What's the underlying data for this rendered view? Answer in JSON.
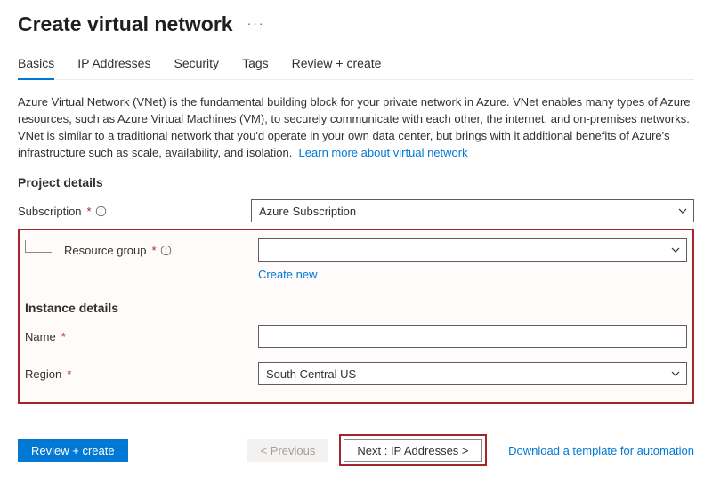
{
  "header": {
    "title": "Create virtual network"
  },
  "tabs": [
    "Basics",
    "IP Addresses",
    "Security",
    "Tags",
    "Review + create"
  ],
  "description": "Azure Virtual Network (VNet) is the fundamental building block for your private network in Azure. VNet enables many types of Azure resources, such as Azure Virtual Machines (VM), to securely communicate with each other, the internet, and on-premises networks. VNet is similar to a traditional network that you'd operate in your own data center, but brings with it additional benefits of Azure's infrastructure such as scale, availability, and isolation.",
  "learnMore": "Learn more about virtual network",
  "projectDetails": {
    "title": "Project details",
    "subscriptionLabel": "Subscription",
    "subscriptionValue": "Azure Subscription",
    "resourceGroupLabel": "Resource group",
    "resourceGroupValue": "",
    "createNew": "Create new"
  },
  "instanceDetails": {
    "title": "Instance details",
    "nameLabel": "Name",
    "nameValue": "",
    "regionLabel": "Region",
    "regionValue": "South Central US"
  },
  "footer": {
    "review": "Review + create",
    "previous": "< Previous",
    "next": "Next : IP Addresses >",
    "download": "Download a template for automation"
  }
}
